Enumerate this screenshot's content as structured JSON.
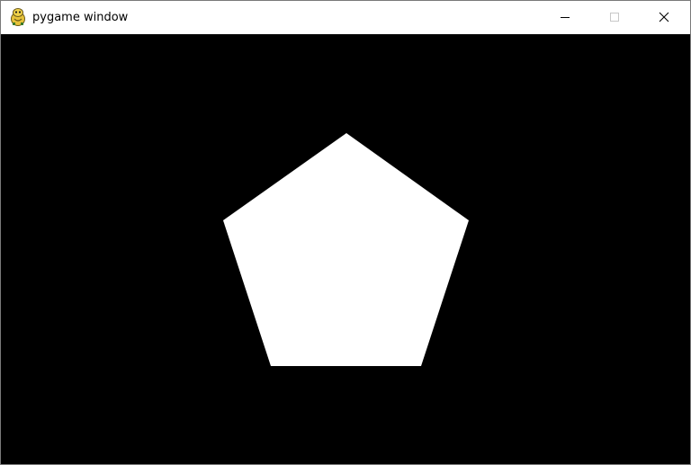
{
  "window": {
    "title": "pygame window",
    "app_icon": "pygame-snake-icon",
    "controls": {
      "minimize": "minimize-icon",
      "maximize": "maximize-icon",
      "close": "close-icon"
    }
  },
  "canvas": {
    "background": "#000000",
    "shape": {
      "type": "pentagon",
      "fill": "#ffffff"
    }
  }
}
